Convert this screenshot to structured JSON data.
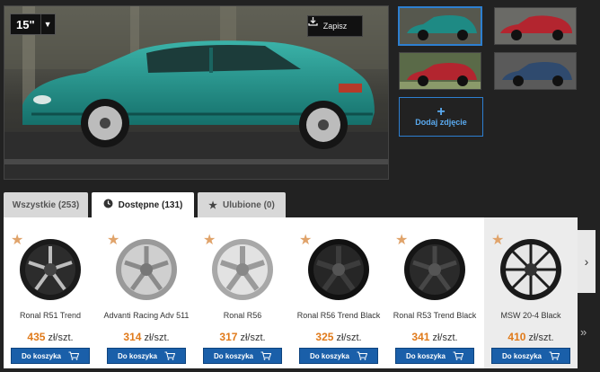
{
  "preview": {
    "size_value": "15\"",
    "save_label": "Zapisz"
  },
  "add_photo_label": "Dodaj zdjęcie",
  "tabs": [
    {
      "label": "Wszystkie (253)"
    },
    {
      "label": "Dostępne (131)"
    },
    {
      "label": "Ulubione (0)"
    }
  ],
  "products": [
    {
      "name": "Ronal R51 Trend",
      "price": "435",
      "unit": "zł/szt.",
      "buy_label": "Do koszyka"
    },
    {
      "name": "Advanti Racing Adv 511",
      "price": "314",
      "unit": "zł/szt.",
      "buy_label": "Do koszyka"
    },
    {
      "name": "Ronal R56",
      "price": "317",
      "unit": "zł/szt.",
      "buy_label": "Do koszyka"
    },
    {
      "name": "Ronal R56 Trend Black",
      "price": "325",
      "unit": "zł/szt.",
      "buy_label": "Do koszyka"
    },
    {
      "name": "Ronal R53 Trend Black",
      "price": "341",
      "unit": "zł/szt.",
      "buy_label": "Do koszyka"
    },
    {
      "name": "MSW 20-4 Black",
      "price": "410",
      "unit": "zł/szt.",
      "buy_label": "Do koszyka"
    }
  ],
  "icons": {
    "dropdown": "chevron-down-icon",
    "save": "download-icon",
    "star": "star-icon",
    "cart": "cart-icon",
    "next": "chevron-right-icon",
    "more": "double-chevron-right-icon",
    "clock": "clock-icon"
  },
  "colors": {
    "accent_blue": "#1a5fa9",
    "price_orange": "#e07a1a",
    "star": "#e0a36a",
    "car_teal": "#1e8a84"
  }
}
